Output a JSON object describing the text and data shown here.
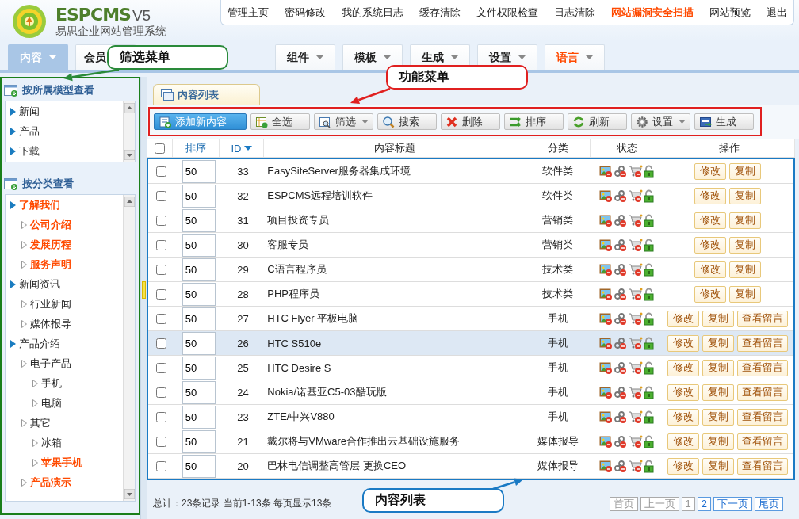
{
  "logo": {
    "brand": "ESPCMS",
    "version": "V5",
    "subtitle": "易思企业网站管理系统"
  },
  "top_links": [
    {
      "label": "管理主页",
      "highlight": false
    },
    {
      "label": "密码修改",
      "highlight": false
    },
    {
      "label": "我的系统日志",
      "highlight": false
    },
    {
      "label": "缓存清除",
      "highlight": false
    },
    {
      "label": "文件权限检查",
      "highlight": false
    },
    {
      "label": "日志清除",
      "highlight": false
    },
    {
      "label": "网站漏洞安全扫描",
      "highlight": true
    },
    {
      "label": "网站预览",
      "highlight": false
    },
    {
      "label": "退出",
      "highlight": false
    }
  ],
  "nav_tabs": [
    {
      "label": "内容",
      "selected": true,
      "highlight": false
    },
    {
      "label": "会员",
      "selected": false,
      "highlight": false
    },
    {
      "label": "组件",
      "selected": false,
      "highlight": false
    },
    {
      "label": "模板",
      "selected": false,
      "highlight": false
    },
    {
      "label": "生成",
      "selected": false,
      "highlight": false
    },
    {
      "label": "设置",
      "selected": false,
      "highlight": false
    },
    {
      "label": "语言",
      "selected": false,
      "highlight": true
    }
  ],
  "sidebar": {
    "sections": [
      {
        "title": "按所属模型查看",
        "items": [
          {
            "label": "新闻",
            "highlight": false
          },
          {
            "label": "产品",
            "highlight": false
          },
          {
            "label": "下载",
            "highlight": false
          }
        ]
      },
      {
        "title": "按分类查看",
        "items": [
          {
            "label": "了解我们",
            "highlight": true,
            "children": [
              {
                "label": "公司介绍",
                "highlight": true
              },
              {
                "label": "发展历程",
                "highlight": true
              },
              {
                "label": "服务声明",
                "highlight": true
              }
            ]
          },
          {
            "label": "新闻资讯",
            "highlight": false,
            "children": [
              {
                "label": "行业新闻",
                "highlight": false
              },
              {
                "label": "媒体报导",
                "highlight": false
              }
            ]
          },
          {
            "label": "产品介绍",
            "highlight": false,
            "children": [
              {
                "label": "电子产品",
                "highlight": false,
                "children": [
                  {
                    "label": "手机",
                    "highlight": false
                  },
                  {
                    "label": "电脑",
                    "highlight": false
                  }
                ]
              },
              {
                "label": "其它",
                "highlight": false,
                "children": [
                  {
                    "label": "冰箱",
                    "highlight": false
                  },
                  {
                    "label": "苹果手机",
                    "highlight": true
                  }
                ]
              },
              {
                "label": "产品演示",
                "highlight": true
              }
            ]
          }
        ]
      }
    ]
  },
  "content_tab": "内容列表",
  "toolbar": [
    {
      "label": "添加新内容",
      "kind": "add",
      "primary": true,
      "dropdown": false
    },
    {
      "label": "全选",
      "kind": "select-all",
      "primary": false,
      "dropdown": false
    },
    {
      "label": "筛选",
      "kind": "filter",
      "primary": false,
      "dropdown": true
    },
    {
      "label": "搜索",
      "kind": "search",
      "primary": false,
      "dropdown": false
    },
    {
      "label": "删除",
      "kind": "delete",
      "primary": false,
      "dropdown": false
    },
    {
      "label": "排序",
      "kind": "sort",
      "primary": false,
      "dropdown": false
    },
    {
      "label": "刷新",
      "kind": "refresh",
      "primary": false,
      "dropdown": false
    },
    {
      "label": "设置",
      "kind": "settings",
      "primary": false,
      "dropdown": true
    },
    {
      "label": "生成",
      "kind": "generate",
      "primary": false,
      "dropdown": false
    }
  ],
  "table": {
    "select_all_checked": false,
    "columns": [
      {
        "label": "排序",
        "link": true,
        "sorted": false
      },
      {
        "label": "ID",
        "link": true,
        "sorted": true
      },
      {
        "label": "内容标题",
        "link": false,
        "sorted": false
      },
      {
        "label": "分类",
        "link": false,
        "sorted": false
      },
      {
        "label": "状态",
        "link": false,
        "sorted": false
      },
      {
        "label": "操作",
        "link": false,
        "sorted": false
      }
    ],
    "rows": [
      {
        "checked": false,
        "selected": false,
        "order": "50",
        "id": "33",
        "title": "EasySiteServer服务器集成环境",
        "category": "软件类",
        "actions": [
          "修改",
          "复制"
        ]
      },
      {
        "checked": false,
        "selected": false,
        "order": "50",
        "id": "32",
        "title": "ESPCMS远程培训软件",
        "category": "软件类",
        "actions": [
          "修改",
          "复制"
        ]
      },
      {
        "checked": false,
        "selected": false,
        "order": "50",
        "id": "31",
        "title": "项目投资专员",
        "category": "营销类",
        "actions": [
          "修改",
          "复制"
        ]
      },
      {
        "checked": false,
        "selected": false,
        "order": "50",
        "id": "30",
        "title": "客服专员",
        "category": "营销类",
        "actions": [
          "修改",
          "复制"
        ]
      },
      {
        "checked": false,
        "selected": false,
        "order": "50",
        "id": "29",
        "title": "C语言程序员",
        "category": "技术类",
        "actions": [
          "修改",
          "复制"
        ]
      },
      {
        "checked": false,
        "selected": false,
        "order": "50",
        "id": "28",
        "title": "PHP程序员",
        "category": "技术类",
        "actions": [
          "修改",
          "复制"
        ]
      },
      {
        "checked": false,
        "selected": false,
        "order": "50",
        "id": "27",
        "title": "HTC Flyer 平板电脑",
        "category": "手机",
        "actions": [
          "修改",
          "复制",
          "查看留言"
        ]
      },
      {
        "checked": false,
        "selected": true,
        "order": "50",
        "id": "26",
        "title": "HTC S510e",
        "category": "手机",
        "actions": [
          "修改",
          "复制",
          "查看留言"
        ]
      },
      {
        "checked": false,
        "selected": false,
        "order": "50",
        "id": "25",
        "title": "HTC Desire S",
        "category": "手机",
        "actions": [
          "修改",
          "复制",
          "查看留言"
        ]
      },
      {
        "checked": false,
        "selected": false,
        "order": "50",
        "id": "24",
        "title": "Nokia/诺基亚C5-03酷玩版",
        "category": "手机",
        "actions": [
          "修改",
          "复制",
          "查看留言"
        ]
      },
      {
        "checked": false,
        "selected": false,
        "order": "50",
        "id": "23",
        "title": "ZTE/中兴V880",
        "category": "手机",
        "actions": [
          "修改",
          "复制",
          "查看留言"
        ]
      },
      {
        "checked": false,
        "selected": false,
        "order": "50",
        "id": "21",
        "title": "戴尔将与VMware合作推出云基础设施服务",
        "category": "媒体报导",
        "actions": [
          "修改",
          "复制",
          "查看留言"
        ]
      },
      {
        "checked": false,
        "selected": false,
        "order": "50",
        "id": "20",
        "title": "巴林电信调整高管层 更换CEO",
        "category": "媒体报导",
        "actions": [
          "修改",
          "复制",
          "查看留言"
        ]
      }
    ]
  },
  "footer": {
    "summary": "总计：23条记录 当前1-13条 每页显示13条",
    "pagination": [
      {
        "label": "首页",
        "disabled": true
      },
      {
        "label": "上一页",
        "disabled": true
      },
      {
        "label": "1",
        "disabled": true
      },
      {
        "label": "2",
        "disabled": false
      },
      {
        "label": "下一页",
        "disabled": false
      },
      {
        "label": "尾页",
        "disabled": false
      }
    ]
  },
  "callouts": [
    {
      "text": "筛选菜单",
      "color": "#2a8a3a"
    },
    {
      "text": "功能菜单",
      "color": "#e02020"
    },
    {
      "text": "内容列表",
      "color": "#1a7ac4"
    }
  ]
}
